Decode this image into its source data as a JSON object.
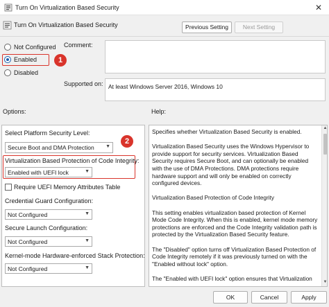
{
  "window": {
    "title": "Turn On Virtualization Based Security",
    "close_glyph": "✕"
  },
  "header": {
    "setting_title": "Turn On Virtualization Based Security",
    "prev_label": "Previous Setting",
    "next_label": "Next Setting"
  },
  "state": {
    "options": [
      {
        "label": "Not Configured",
        "selected": false
      },
      {
        "label": "Enabled",
        "selected": true
      },
      {
        "label": "Disabled",
        "selected": false
      }
    ]
  },
  "comment": {
    "label": "Comment:",
    "value": ""
  },
  "supported": {
    "label": "Supported on:",
    "value": "At least Windows Server 2016, Windows 10"
  },
  "sections": {
    "options_label": "Options:",
    "help_label": "Help:"
  },
  "options_panel": {
    "platform_label": "Select Platform Security Level:",
    "platform_value": "Secure Boot and DMA Protection",
    "vbp_label": "Virtualization Based Protection of Code Integrity:",
    "vbp_value": "Enabled with UEFI lock",
    "uefi_mat_label": "Require UEFI Memory Attributes Table",
    "credguard_label": "Credential Guard Configuration:",
    "credguard_value": "Not Configured",
    "securelaunch_label": "Secure Launch Configuration:",
    "securelaunch_value": "Not Configured",
    "kernelstack_label": "Kernel-mode Hardware-enforced Stack Protection:",
    "kernelstack_value": "Not Configured"
  },
  "help": {
    "paragraphs": [
      "Specifies whether Virtualization Based Security is enabled.",
      "Virtualization Based Security uses the Windows Hypervisor to provide support for security services. Virtualization Based Security requires Secure Boot, and can optionally be enabled with the use of DMA Protections. DMA protections require hardware support and will only be enabled on correctly configured devices.",
      "Virtualization Based Protection of Code Integrity",
      "This setting enables virtualization based protection of Kernel Mode Code Integrity. When this is enabled, kernel mode memory protections are enforced and the Code Integrity validation path is protected by the Virtualization Based Security feature.",
      "The \"Disabled\" option turns off Virtualization Based Protection of Code Integrity remotely if it was previously turned on with the \"Enabled without lock\" option.",
      "The \"Enabled with UEFI lock\" option ensures that Virtualization"
    ]
  },
  "annotations": {
    "badge_1": "1",
    "badge_2": "2",
    "highlight_color": "#d9342b"
  },
  "footer": {
    "ok_label": "OK",
    "cancel_label": "Cancel",
    "apply_label": "Apply"
  },
  "colors": {
    "accent": "#1a5dad",
    "annotation": "#d9342b"
  }
}
